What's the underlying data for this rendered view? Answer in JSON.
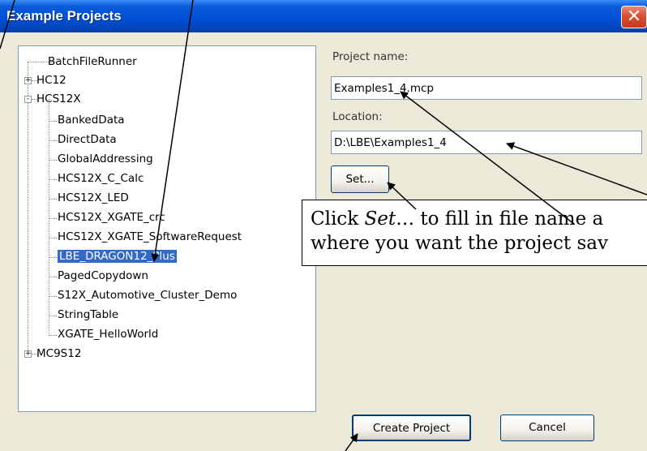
{
  "window": {
    "title": "Example Projects",
    "close_glyph": "✕"
  },
  "tree": {
    "items": [
      {
        "label": "BatchFileRunner"
      },
      {
        "label": "HC12",
        "expander": "+"
      },
      {
        "label": "HCS12X",
        "expander": "-"
      },
      {
        "label": "BankedData"
      },
      {
        "label": "DirectData"
      },
      {
        "label": "GlobalAddressing"
      },
      {
        "label": "HCS12X_C_Calc"
      },
      {
        "label": "HCS12X_LED"
      },
      {
        "label": "HCS12X_XGATE_crc"
      },
      {
        "label": "HCS12X_XGATE_SoftwareRequest"
      },
      {
        "label": "LBE_DRAGON12_Plus",
        "selected": true
      },
      {
        "label": "PagedCopydown"
      },
      {
        "label": "S12X_Automotive_Cluster_Demo"
      },
      {
        "label": "StringTable"
      },
      {
        "label": "XGATE_HelloWorld"
      },
      {
        "label": "MC9S12",
        "expander": "+"
      }
    ]
  },
  "form": {
    "project_name_label": "Project name:",
    "project_name_value": "Examples1_4.mcp",
    "location_label": "Location:",
    "location_value": "D:\\LBE\\Examples1_4",
    "set_button": "Set..."
  },
  "callout": {
    "line1_prefix": "Click ",
    "line1_emph": "Set",
    "line1_rest": "… to fill in file name a",
    "line2": "where you want the project sav"
  },
  "footer": {
    "create_button": "Create Project",
    "cancel_button": "Cancel"
  },
  "colors": {
    "title_bar": "#0050d6",
    "selection": "#316ac5",
    "dialog_bg": "#ece9d8",
    "close_button": "#d8502f"
  }
}
